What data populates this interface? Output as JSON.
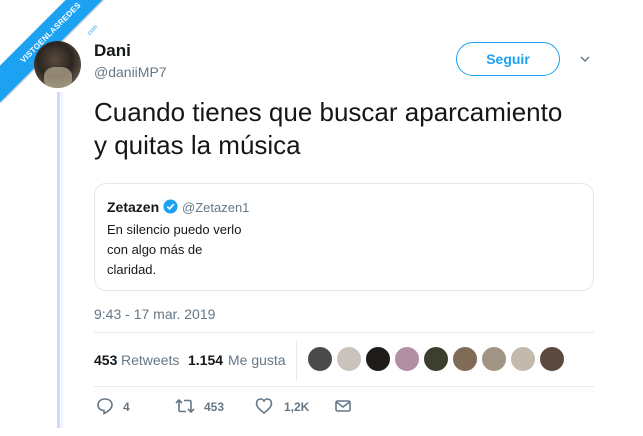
{
  "watermark": {
    "text": "VISTOENLASREDES",
    "domain": ".com"
  },
  "author": {
    "name": "Dani",
    "handle": "@daniiMP7"
  },
  "follow_label": "Seguir",
  "tweet": {
    "line1": "Cuando tienes que buscar aparcamiento",
    "line2": "y quitas la música"
  },
  "quoted": {
    "name": "Zetazen",
    "handle": "@Zetazen1",
    "lines": [
      "En silencio puedo verlo",
      "con algo más de",
      "claridad."
    ]
  },
  "timestamp": "9:43 - 17 mar. 2019",
  "stats": {
    "retweets": "453",
    "retweets_label": "Retweets",
    "likes": "1.154",
    "likes_label": "Me gusta"
  },
  "actions": {
    "replies": "4",
    "retweets": "453",
    "likes": "1,2K"
  },
  "colors": {
    "accent": "#1da1f2",
    "muted": "#657786",
    "text": "#14171a",
    "verified": "#1da1f2"
  },
  "icons": [
    "caret-down-icon",
    "verified-badge-icon",
    "reply-icon",
    "retweet-icon",
    "heart-icon",
    "message-icon"
  ]
}
